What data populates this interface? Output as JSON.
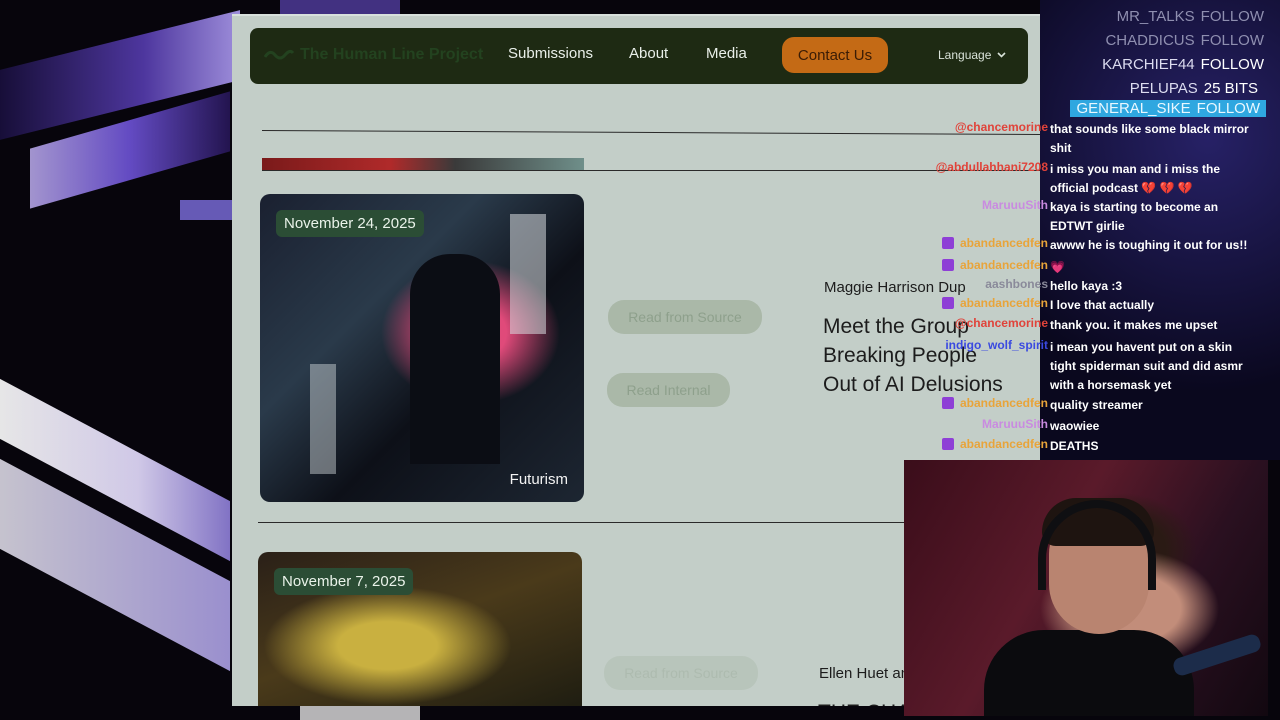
{
  "nav": {
    "logo": "The Human Line Project",
    "links": [
      "Submissions",
      "About",
      "Media"
    ],
    "contact": "Contact Us",
    "language": "Language"
  },
  "cards": [
    {
      "date": "November 24, 2025",
      "tag": "Futurism",
      "read_source": "Read from Source",
      "read_internal": "Read Internal",
      "author": "Maggie Harrison Dup",
      "headline": "Meet the Group Breaking People Out of AI Delusions"
    },
    {
      "date": "November 7, 2025",
      "read_source": "Read from Source",
      "author": "Ellen Huet an",
      "headline": "THE CHA"
    }
  ],
  "alerts": [
    {
      "name": "MR_TALKS",
      "action": "FOLLOW",
      "style": "dim"
    },
    {
      "name": "CHADDICUS",
      "action": "FOLLOW",
      "style": "dim"
    },
    {
      "name": "KARCHIEF44",
      "action": "FOLLOW",
      "style": "normal"
    },
    {
      "name": "PELUPAS",
      "action": "25 BITS",
      "style": "normal"
    },
    {
      "name": "GENERAL_SIKE",
      "action": "FOLLOW",
      "style": "highlight"
    }
  ],
  "chat": [
    {
      "user": "@chancemorine",
      "color": "#e0433a",
      "badge": false,
      "text": "that sounds like some black mirror shit"
    },
    {
      "user": "@abdullahhani7208",
      "color": "#e0433a",
      "badge": false,
      "text": "i miss you man and i miss the official podcast 💔 💔 💔"
    },
    {
      "user": "MaruuuSith",
      "color": "#c98be0",
      "badge": false,
      "text": "kaya is starting to become an EDTWT girlie"
    },
    {
      "user": "abandancedfen",
      "color": "#e8a43a",
      "badge": true,
      "text": "awww he is toughing it out for us!!"
    },
    {
      "user": "abandancedfen",
      "color": "#e8a43a",
      "badge": true,
      "text": "💗"
    },
    {
      "user": "aashbones",
      "color": "#8a8a9a",
      "badge": false,
      "text": "hello kaya :3"
    },
    {
      "user": "abandancedfen",
      "color": "#e8a43a",
      "badge": true,
      "text": "I love that actually"
    },
    {
      "user": "@chancemorine",
      "color": "#e0433a",
      "badge": false,
      "text": "thank you. it makes me upset"
    },
    {
      "user": "indigo_wolf_spirit",
      "color": "#3a4ae0",
      "badge": false,
      "text": "i mean you havent put on a skin tight spiderman suit and did asmr with a horsemask yet"
    },
    {
      "user": "abandancedfen",
      "color": "#e8a43a",
      "badge": true,
      "text": "quality streamer"
    },
    {
      "user": "MaruuuSith",
      "color": "#c98be0",
      "badge": false,
      "text": "waowiee"
    },
    {
      "user": "abandancedfen",
      "color": "#e8a43a",
      "badge": true,
      "text": "DEATHS"
    }
  ]
}
